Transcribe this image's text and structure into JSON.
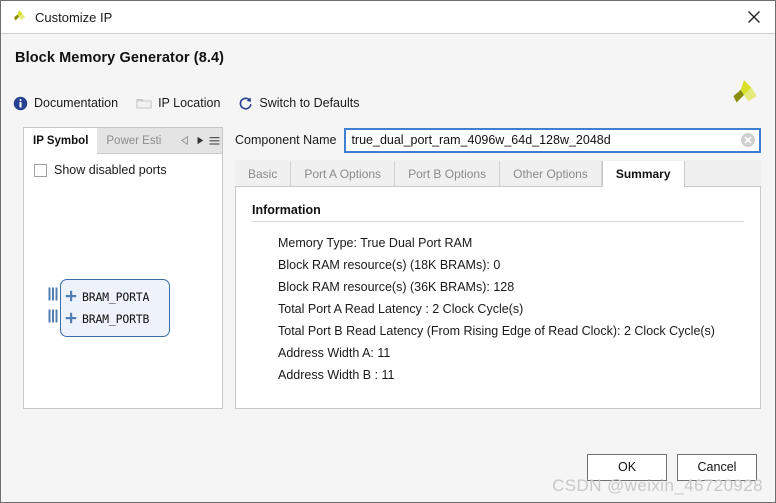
{
  "window": {
    "title": "Customize IP",
    "app_icon": "xilinx-logo-icon",
    "close_icon": "close-icon"
  },
  "header": {
    "title": "Block Memory Generator (8.4)",
    "logo_icon": "xilinx-logo-icon"
  },
  "toolbar": {
    "items": [
      {
        "label": "Documentation",
        "icon": "info-icon",
        "enabled": true
      },
      {
        "label": "IP Location",
        "icon": "folder-icon",
        "enabled": false
      },
      {
        "label": "Switch to Defaults",
        "icon": "refresh-icon",
        "enabled": true
      }
    ]
  },
  "left_panel": {
    "tabs": [
      {
        "label": "IP Symbol",
        "active": true
      },
      {
        "label": "Power Esti",
        "active": false
      }
    ],
    "nav": {
      "prev_icon": "chevron-left-icon",
      "next_icon": "chevron-right-icon",
      "menu_icon": "hamburger-menu-icon"
    },
    "show_disabled_ports": {
      "label": "Show disabled ports",
      "checked": false
    },
    "symbol": {
      "ports": [
        {
          "label": "BRAM_PORTA",
          "expander": "plus-icon"
        },
        {
          "label": "BRAM_PORTB",
          "expander": "plus-icon"
        }
      ],
      "border_color": "#3b6ea5",
      "fill_color": "#eef2fa",
      "port_color": "#3b6ea5"
    }
  },
  "component_name": {
    "label": "Component Name",
    "value": "true_dual_port_ram_4096w_64d_128w_2048d",
    "placeholder": "",
    "clear_icon": "clear-circle-icon",
    "focus_color": "#3f7fd0"
  },
  "tabs": [
    {
      "label": "Basic",
      "active": false
    },
    {
      "label": "Port A Options",
      "active": false
    },
    {
      "label": "Port B Options",
      "active": false
    },
    {
      "label": "Other Options",
      "active": false
    },
    {
      "label": "Summary",
      "active": true
    }
  ],
  "summary": {
    "heading": "Information",
    "lines": [
      "Memory Type: True Dual Port RAM",
      "Block RAM resource(s) (18K BRAMs): 0",
      "Block RAM resource(s) (36K BRAMs): 128",
      "Total Port A Read Latency : 2 Clock Cycle(s)",
      "Total Port B Read Latency (From Rising Edge of Read Clock): 2 Clock Cycle(s)",
      "Address Width A: 11",
      "Address Width B : 11"
    ]
  },
  "footer": {
    "ok_label": "OK",
    "cancel_label": "Cancel"
  },
  "watermark": {
    "text": "CSDN @weixin_46720928"
  }
}
